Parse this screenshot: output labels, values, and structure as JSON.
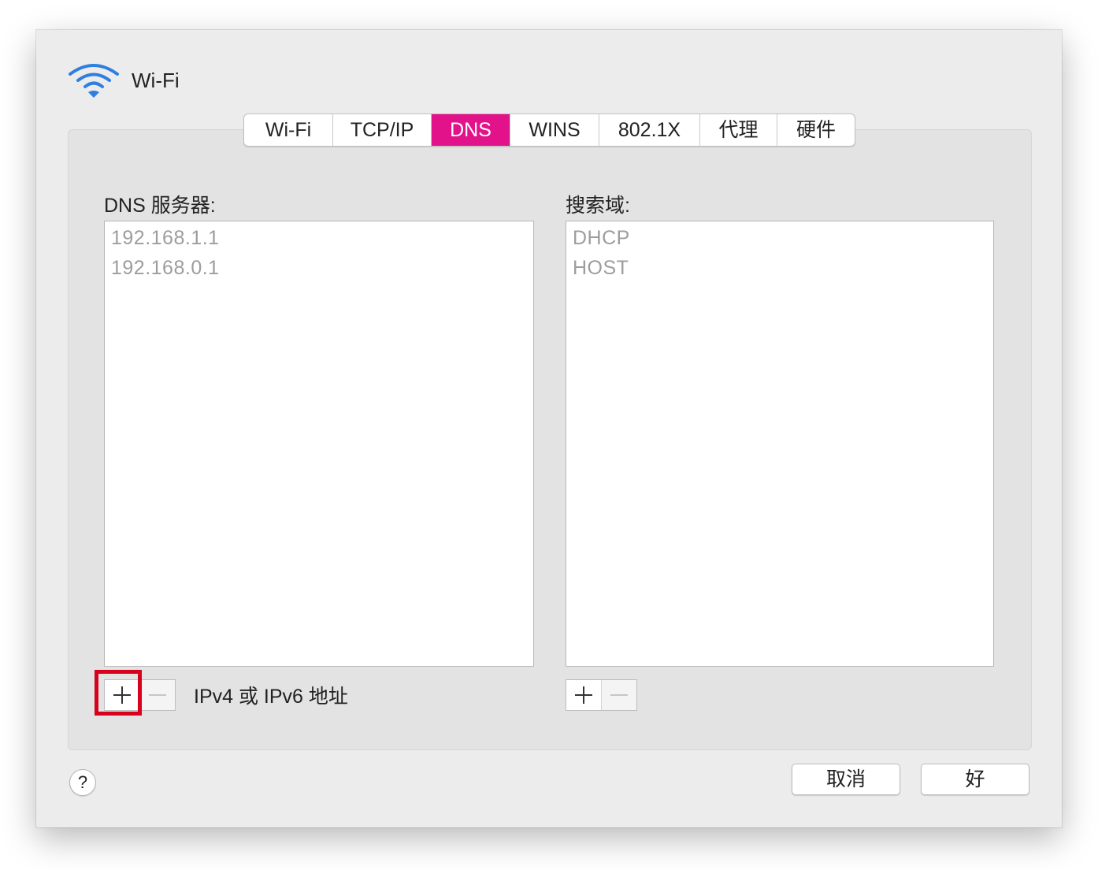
{
  "window": {
    "title": "Wi-Fi",
    "icon": "wifi-icon"
  },
  "tabs": [
    {
      "label": "Wi-Fi",
      "active": false
    },
    {
      "label": "TCP/IP",
      "active": false
    },
    {
      "label": "DNS",
      "active": true
    },
    {
      "label": "WINS",
      "active": false
    },
    {
      "label": "802.1X",
      "active": false
    },
    {
      "label": "代理",
      "active": false
    },
    {
      "label": "硬件",
      "active": false
    }
  ],
  "dns": {
    "label": "DNS 服务器:",
    "servers": [
      "192.168.1.1",
      "192.168.0.1"
    ],
    "hint": "IPv4 或 IPv6 地址"
  },
  "search": {
    "label": "搜索域:",
    "domains": [
      "DHCP",
      "HOST"
    ]
  },
  "footer": {
    "help_label": "?",
    "cancel_label": "取消",
    "ok_label": "好"
  },
  "colors": {
    "active_tab": "#e1128a",
    "highlight": "#d8001c",
    "wifi_icon": "#2f7fe0"
  }
}
